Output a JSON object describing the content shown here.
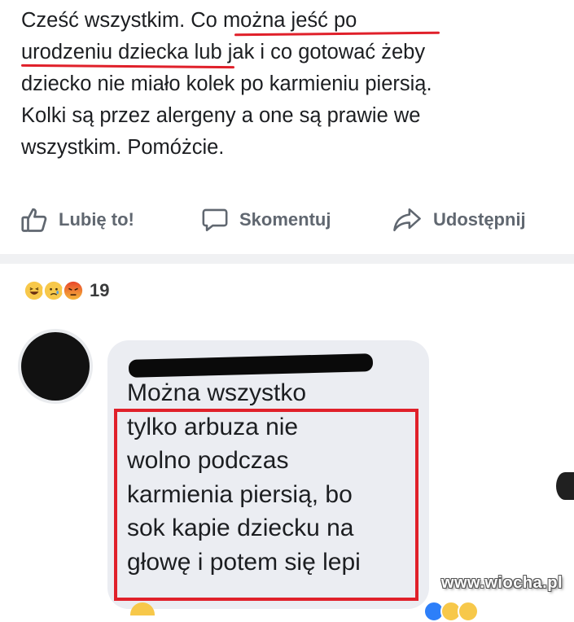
{
  "post": {
    "lines": [
      "Cześć wszystkim. Co można jeść po",
      "urodzeniu dziecka lub jak i co gotować żeby",
      "dziecko nie miało kolek po karmieniu piersią.",
      "Kolki są przez alergeny a one są prawie we",
      "wszystkim. Pomóżcie."
    ]
  },
  "actions": {
    "like_label": "Lubię to!",
    "comment_label": "Skomentuj",
    "share_label": "Udostępnij"
  },
  "reactions": {
    "count": "19",
    "icons": [
      "haha-icon",
      "sad-icon",
      "angry-icon"
    ]
  },
  "comment": {
    "lines": [
      "Można wszystko",
      "tylko arbuza nie",
      "wolno podczas",
      "karmienia piersią, bo",
      "sok kapie dziecku na",
      "głowę i potem się lepi"
    ]
  },
  "watermark": "www.wiocha.pl",
  "colors": {
    "highlight": "#e0202a",
    "action_text": "#606770",
    "bubble": "#ebedf2"
  }
}
